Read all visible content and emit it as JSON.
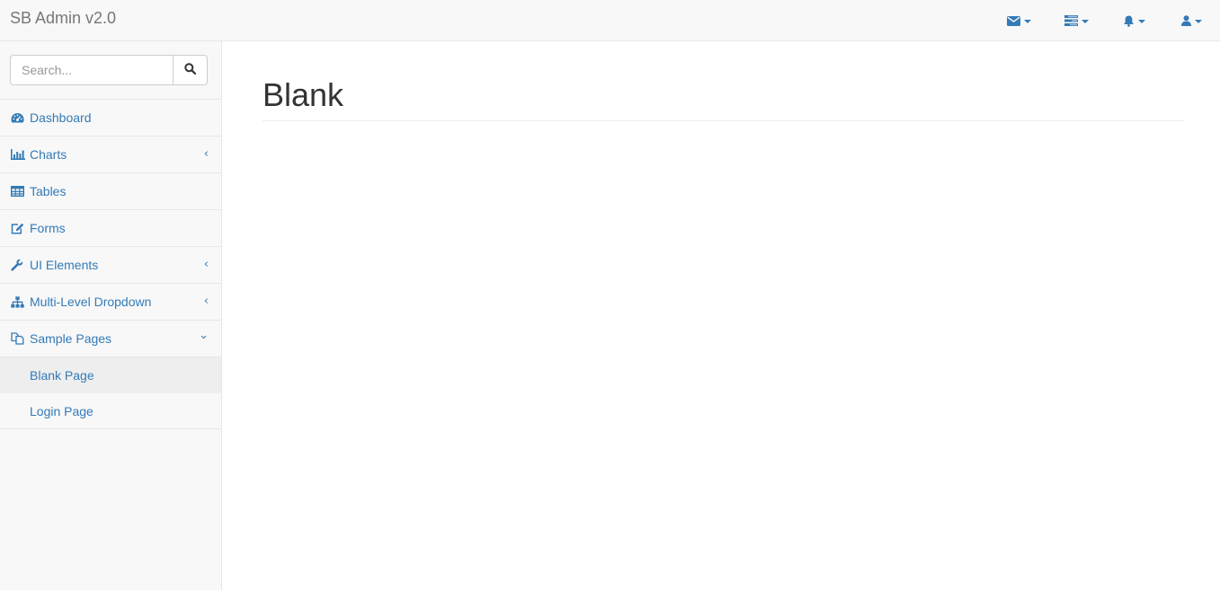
{
  "navbar": {
    "brand": "SB Admin v2.0",
    "links": [
      {
        "icon": "envelope-icon"
      },
      {
        "icon": "tasks-icon"
      },
      {
        "icon": "bell-icon"
      },
      {
        "icon": "user-icon"
      }
    ]
  },
  "sidebar": {
    "search": {
      "placeholder": "Search..."
    },
    "items": [
      {
        "label": "Dashboard",
        "icon": "dashboard-icon",
        "arrow": ""
      },
      {
        "label": "Charts",
        "icon": "bar-chart-icon",
        "arrow": "‹"
      },
      {
        "label": "Tables",
        "icon": "table-icon",
        "arrow": ""
      },
      {
        "label": "Forms",
        "icon": "edit-icon",
        "arrow": ""
      },
      {
        "label": "UI Elements",
        "icon": "wrench-icon",
        "arrow": "‹"
      },
      {
        "label": "Multi-Level Dropdown",
        "icon": "sitemap-icon",
        "arrow": "‹"
      },
      {
        "label": "Sample Pages",
        "icon": "files-icon",
        "arrow": "⌄"
      }
    ],
    "subitems": [
      {
        "label": "Blank Page",
        "active": true
      },
      {
        "label": "Login Page",
        "active": false
      }
    ]
  },
  "main": {
    "title": "Blank"
  },
  "colors": {
    "link": "#337ab7",
    "navbar_bg": "#f8f8f8",
    "border": "#e7e7e7",
    "active_bg": "#eeeeee"
  }
}
